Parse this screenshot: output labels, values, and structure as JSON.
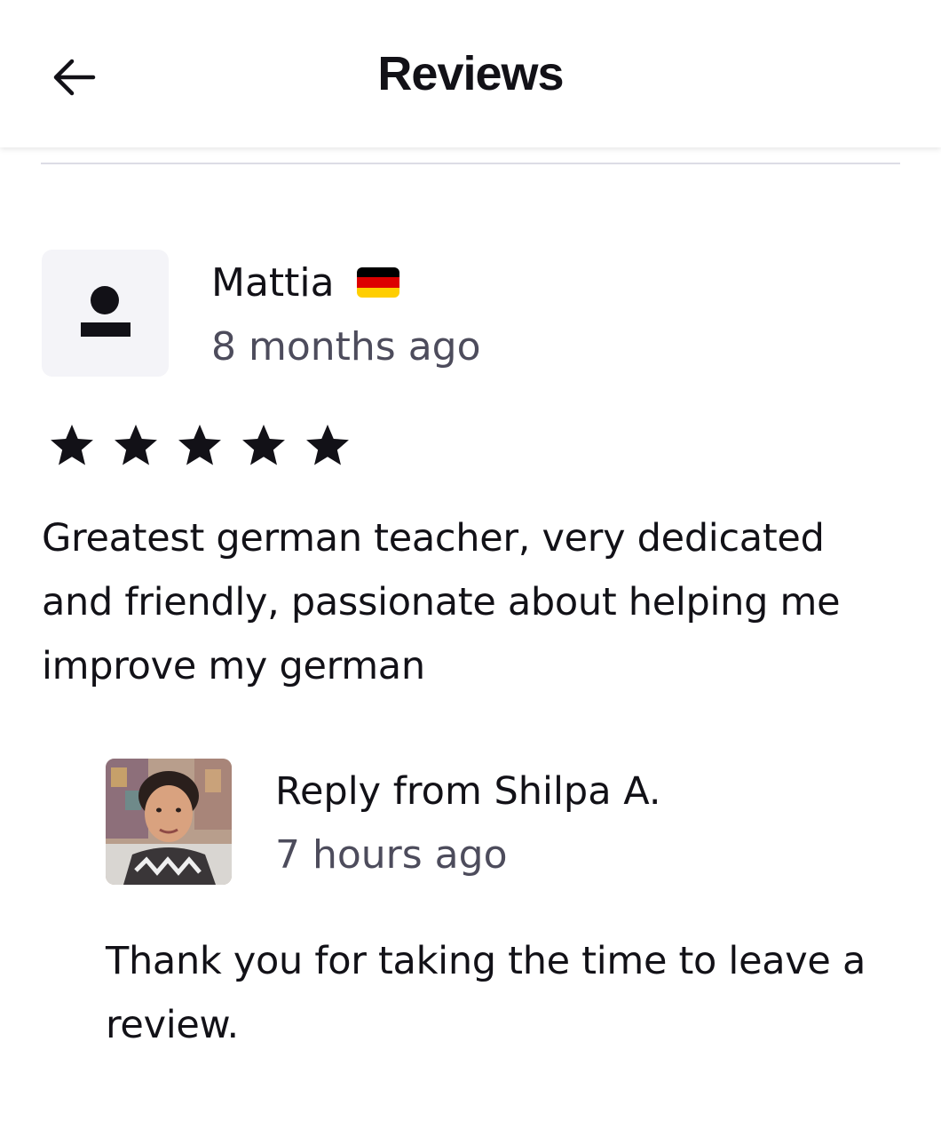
{
  "header": {
    "title": "Reviews",
    "back_icon": "arrow-left-icon"
  },
  "review": {
    "author": "Mattia",
    "country_flag": "germany-flag-icon",
    "flag_colors": [
      "#000000",
      "#dd0000",
      "#ffce00"
    ],
    "time": "8 months ago",
    "rating": 5,
    "rating_max": 5,
    "text": "Greatest german teacher, very dedicated and friendly, passionate about helping me improve my german",
    "avatar_icon": "user-placeholder-icon"
  },
  "reply": {
    "title": "Reply from Shilpa A.",
    "time": "7 hours ago",
    "text": "Thank you for taking the time to leave a review."
  },
  "colors": {
    "text_primary": "#121117",
    "text_secondary": "#4d4c5c",
    "avatar_bg": "#f4f4f8",
    "divider": "#dcdce5"
  }
}
